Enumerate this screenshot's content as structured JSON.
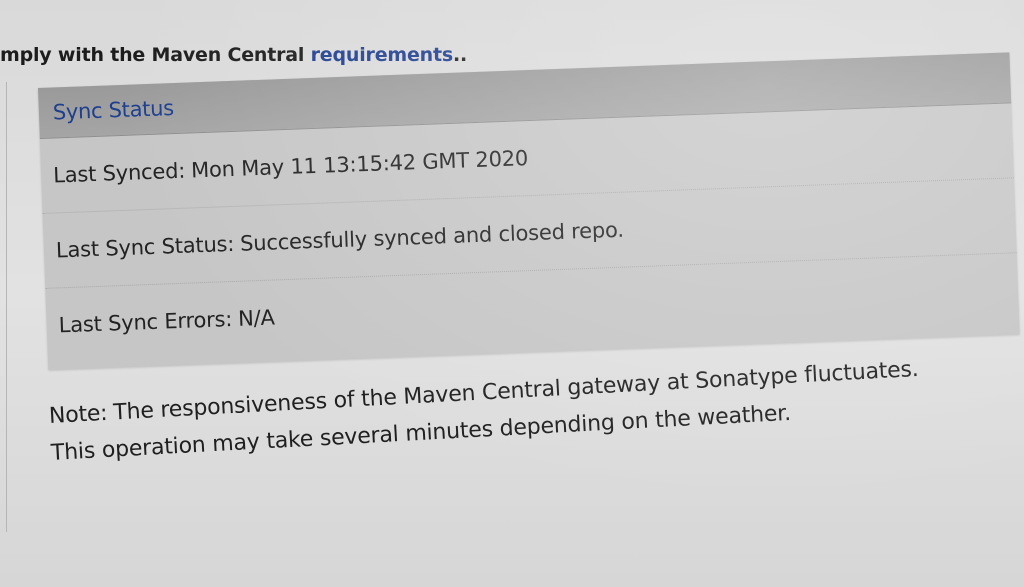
{
  "header": {
    "intro_text": "mply with the Maven Central",
    "link_text": "requirements",
    "trailing_text": ".."
  },
  "sync_panel": {
    "title": "Sync Status",
    "rows": [
      {
        "label": "Last Synced:",
        "value": "Mon May 11 13:15:42 GMT 2020"
      },
      {
        "label": "Last Sync Status:",
        "value": "Successfully synced and closed repo."
      },
      {
        "label": "Last Sync Errors:",
        "value": "N/A"
      }
    ]
  },
  "note": {
    "prefix": "Note:",
    "line1": "The responsiveness of the Maven Central gateway at Sonatype fluctuates.",
    "line2": "This operation may take several minutes depending on the weather."
  },
  "colors": {
    "link": "#1e3e8e",
    "panel_header_bg": "#a0a0a0",
    "panel_body_bg": "#c6c6c6",
    "page_bg": "#dcdcdc"
  }
}
